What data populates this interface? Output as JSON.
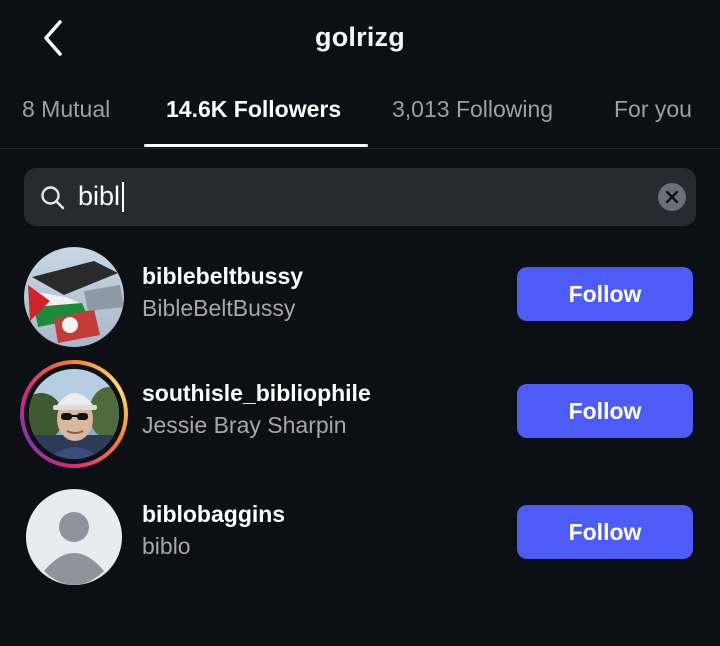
{
  "header": {
    "title": "golrizg"
  },
  "tabs": [
    {
      "label": "8 Mutual",
      "active": false
    },
    {
      "label": "14.6K Followers",
      "active": true
    },
    {
      "label": "3,013 Following",
      "active": false
    },
    {
      "label": "For you",
      "active": false
    }
  ],
  "search": {
    "value": "bibl",
    "icon": "search-icon",
    "clear_icon": "clear-icon"
  },
  "results": [
    {
      "username": "biblebeltbussy",
      "full_name": "BibleBeltBussy",
      "button_label": "Follow",
      "has_story": false,
      "avatar": "flags-photo"
    },
    {
      "username": "southisle_bibliophile",
      "full_name": "Jessie Bray Sharpin",
      "button_label": "Follow",
      "has_story": true,
      "avatar": "person-photo"
    },
    {
      "username": "biblobaggins",
      "full_name": "biblo",
      "button_label": "Follow",
      "has_story": false,
      "avatar": "default-avatar"
    }
  ],
  "colors": {
    "background": "#0c0f14",
    "follow_button": "#4d5cf6",
    "search_bg": "#262a31",
    "secondary_text": "#a3a8b0"
  }
}
